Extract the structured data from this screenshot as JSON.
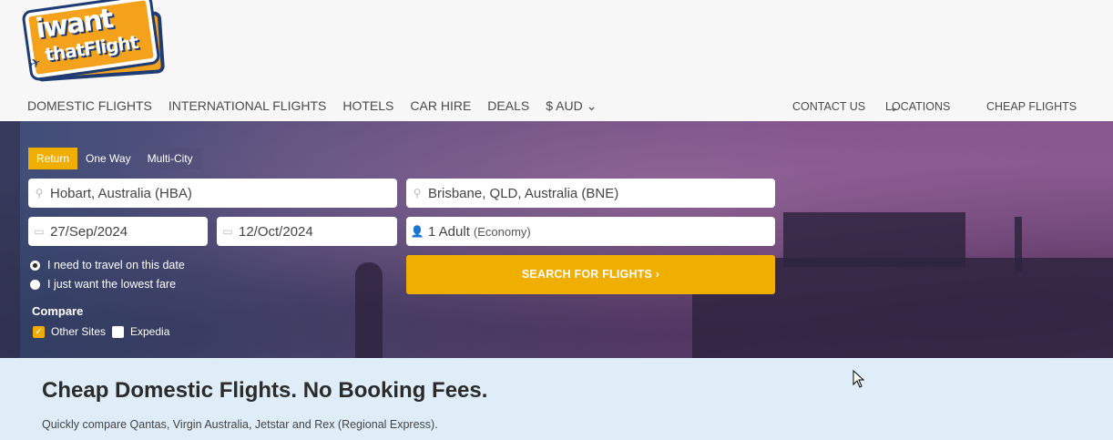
{
  "brand": {
    "logo_line1": "iwant",
    "logo_line2": "thatFlight"
  },
  "nav": {
    "left": [
      "DOMESTIC FLIGHTS",
      "INTERNATIONAL FLIGHTS",
      "HOTELS",
      "CAR HIRE",
      "DEALS",
      "$ AUD"
    ],
    "right": [
      "CONTACT US",
      "LOCATIONS",
      "CHEAP FLIGHTS"
    ]
  },
  "search": {
    "tabs": [
      "Return",
      "One Way",
      "Multi-City"
    ],
    "active_tab": "Return",
    "from": "Hobart, Australia (HBA)",
    "to": "Brisbane, QLD, Australia (BNE)",
    "depart_date": "27/Sep/2024",
    "return_date": "12/Oct/2024",
    "passengers": "1 Adult",
    "cabin": "(Economy)",
    "date_options": [
      "I need to travel on this date",
      "I just want the lowest fare"
    ],
    "selected_date_option": "I need to travel on this date",
    "compare_label": "Compare",
    "compare_options": [
      {
        "label": "Other Sites",
        "checked": true
      },
      {
        "label": "Expedia",
        "checked": false
      }
    ],
    "search_button": "SEARCH FOR FLIGHTS ›"
  },
  "content": {
    "heading": "Cheap Domestic Flights. No Booking Fees.",
    "subtext": "Quickly compare Qantas, Virgin Australia, Jetstar and Rex (Regional Express)."
  },
  "colors": {
    "accent": "#f0ae00",
    "logo_orange": "#f4a21b",
    "logo_navy": "#1f3b73",
    "bottom_bg": "#deedf7"
  }
}
